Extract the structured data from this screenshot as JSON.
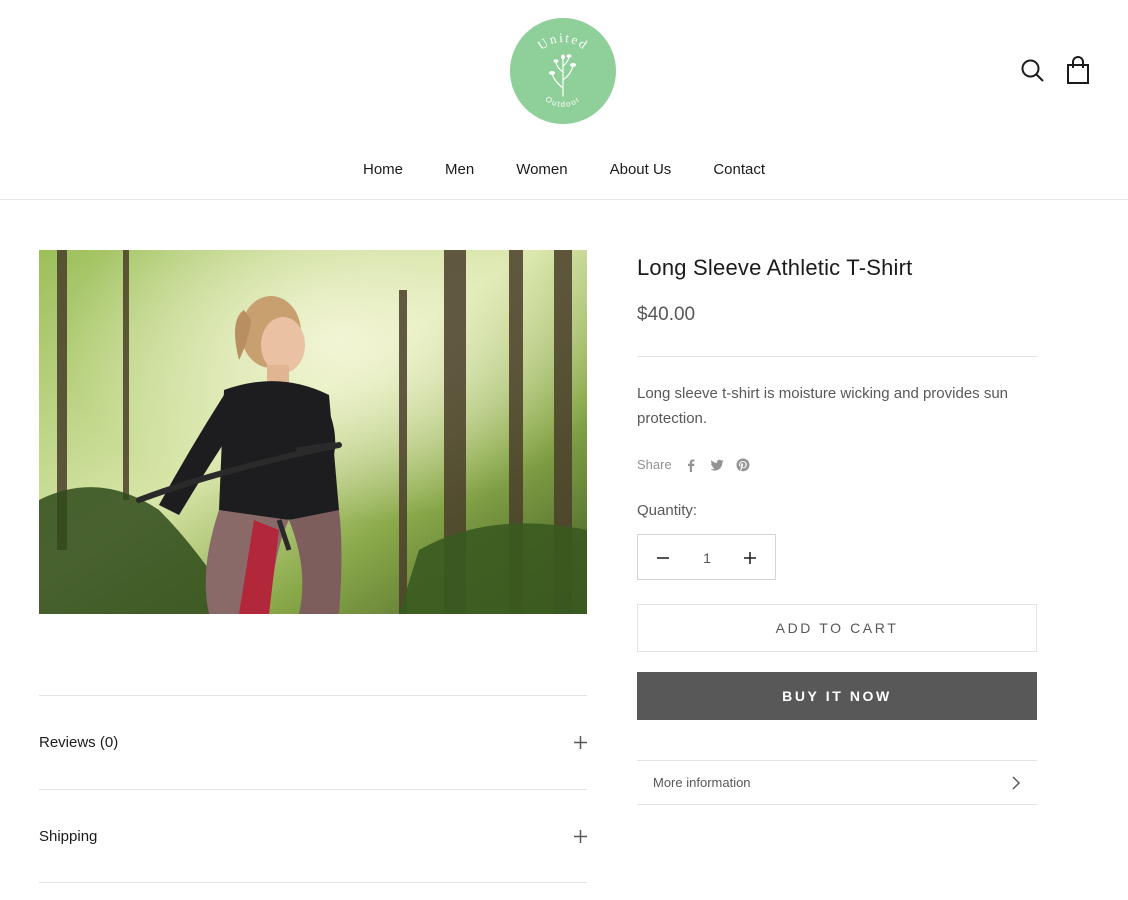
{
  "header": {
    "logo_text_top": "United",
    "logo_text_bottom": "Outdoor",
    "logo_color": "#8fcf99",
    "search_icon": "search-icon",
    "cart_icon": "shopping-bag-icon"
  },
  "nav": {
    "items": [
      {
        "label": "Home"
      },
      {
        "label": "Men"
      },
      {
        "label": "Women"
      },
      {
        "label": "About Us"
      },
      {
        "label": "Contact"
      }
    ]
  },
  "product": {
    "title": "Long Sleeve Athletic T-Shirt",
    "price": "$40.00",
    "description": "Long sleeve t-shirt is moisture wicking and provides sun protection.",
    "share_label": "Share",
    "share_icons": [
      "facebook-icon",
      "twitter-icon",
      "pinterest-icon"
    ],
    "quantity_label": "Quantity:",
    "quantity_value": "1",
    "add_to_cart_label": "ADD TO CART",
    "buy_now_label": "BUY IT NOW",
    "more_info_label": "More information"
  },
  "accordions": {
    "reviews_label": "Reviews",
    "reviews_count": "(0)",
    "shipping_label": "Shipping"
  },
  "colors": {
    "text": "#1c1b1b",
    "muted": "#585858",
    "button_dark": "#585858",
    "border": "#e3e3e3"
  }
}
